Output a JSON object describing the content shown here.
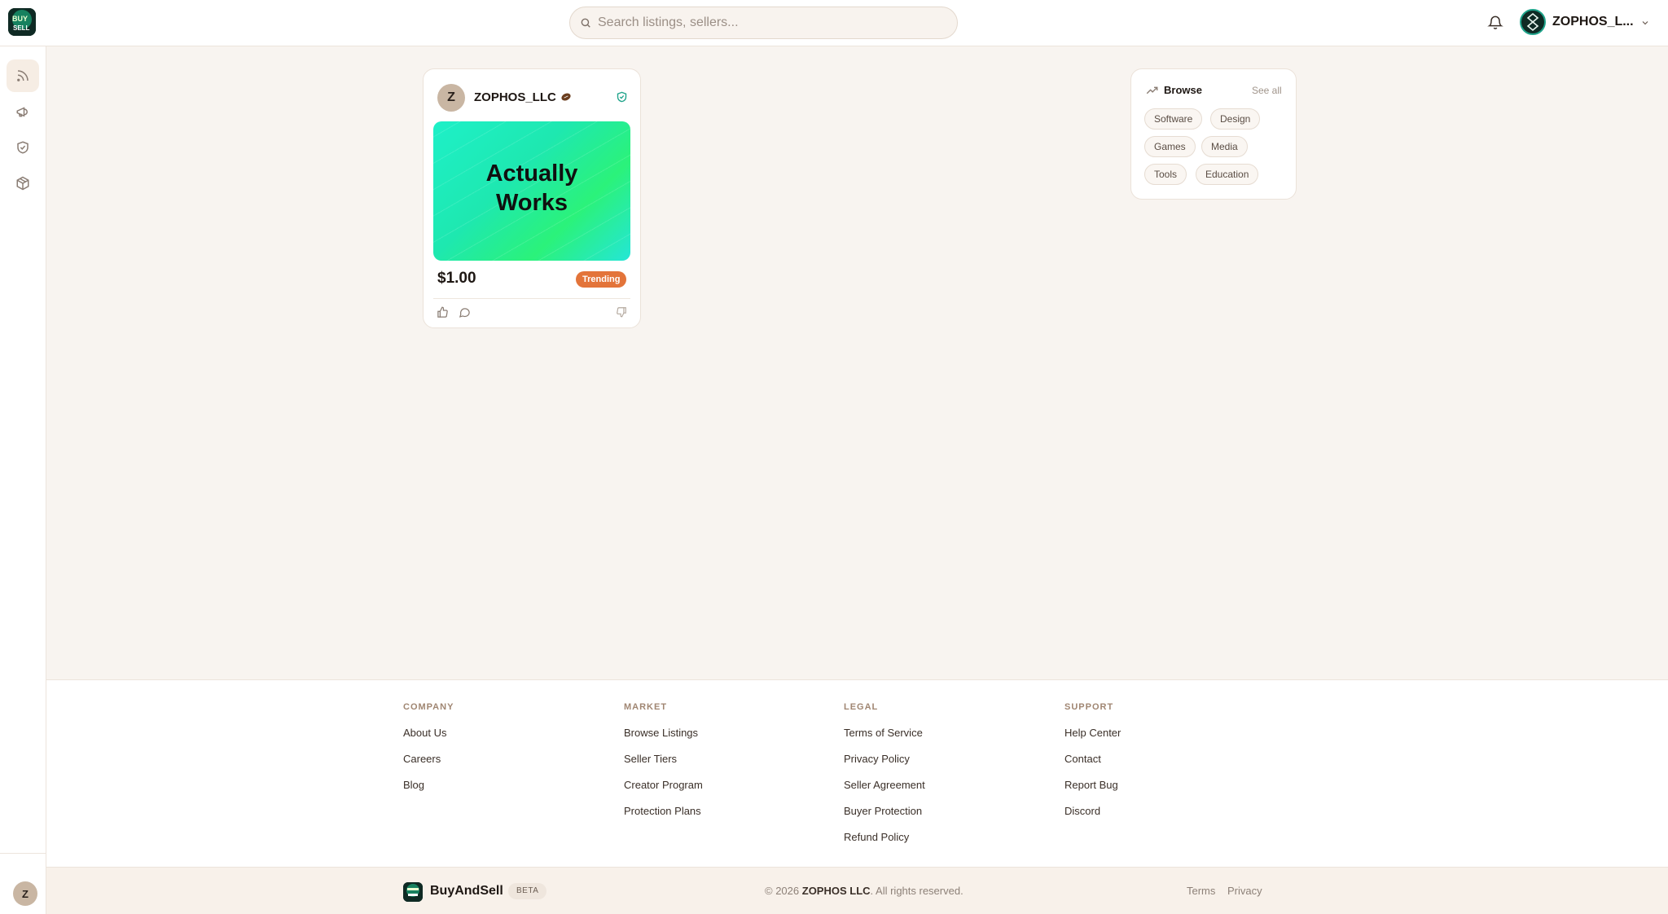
{
  "header": {
    "logo_icon": "buyandsell-logo-icon",
    "search_placeholder": "Search listings, sellers...",
    "search_icon": "search-icon",
    "bell_icon": "bell-icon",
    "user_name": "ZOPHOS_L...",
    "menu_icon": "chevron-down-icon"
  },
  "sidebar": {
    "items": [
      {
        "icon": "rss-feed-icon",
        "active": true
      },
      {
        "icon": "megaphone-icon",
        "active": false
      },
      {
        "icon": "shield-check-icon",
        "active": false
      },
      {
        "icon": "package-icon",
        "active": false
      }
    ],
    "avatar_initial": "Z"
  },
  "listing": {
    "seller_initial": "Z",
    "seller_name": "ZOPHOS_LLC",
    "seller_badge_icon": "football-badge-icon",
    "verified_icon": "verified-shield-icon",
    "thumbnail_text": "Actually Works",
    "price": "$1.00",
    "badge": "Trending",
    "badge_color": "#e3743a",
    "actions": [
      "thumbs-up-icon",
      "comment-icon",
      "thumbs-down-icon"
    ]
  },
  "browse": {
    "title": "Browse",
    "see_all": "See all",
    "icon": "trending-up-icon",
    "categories": [
      "Software",
      "Design",
      "Games",
      "Media",
      "Tools",
      "Education"
    ]
  },
  "footer": {
    "columns": [
      {
        "heading": "COMPANY",
        "links": [
          "About Us",
          "Careers",
          "Blog"
        ]
      },
      {
        "heading": "MARKET",
        "links": [
          "Browse Listings",
          "Seller Tiers",
          "Creator Program",
          "Protection Plans"
        ]
      },
      {
        "heading": "LEGAL",
        "links": [
          "Terms of Service",
          "Privacy Policy",
          "Seller Agreement",
          "Buyer Protection",
          "Refund Policy"
        ]
      },
      {
        "heading": "SUPPORT",
        "links": [
          "Help Center",
          "Contact",
          "Report Bug",
          "Discord"
        ]
      }
    ],
    "brand": "BuyAndSell",
    "beta": "BETA",
    "copyright_prefix": "© 2026",
    "copyright_owner": "ZOPHOS LLC",
    "copyright_suffix": ". All rights reserved.",
    "terms": "Terms",
    "privacy": "Privacy"
  },
  "colors": {
    "background": "#f8f4f0",
    "accent_teal": "#1fa38a",
    "trending": "#e3743a"
  }
}
